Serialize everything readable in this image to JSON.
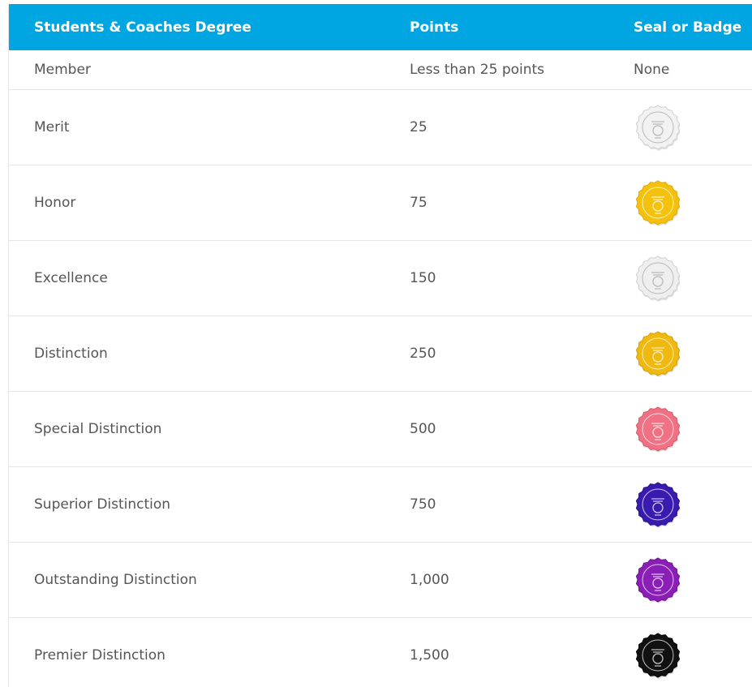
{
  "table": {
    "headers": {
      "degree": "Students & Coaches Degree",
      "points": "Points",
      "seal": "Seal or Badge"
    },
    "rows": [
      {
        "degree": "Member",
        "points": "Less than 25 points",
        "seal": "None"
      },
      {
        "degree": "Merit",
        "points": "25",
        "seal_color": "#f2f2f2",
        "seal_edge": "#d4d4d4",
        "seal_icon": "white-seal-icon"
      },
      {
        "degree": "Honor",
        "points": "75",
        "seal_color": "#f4c20d",
        "seal_edge": "#e0a800",
        "seal_icon": "gold-seal-icon"
      },
      {
        "degree": "Excellence",
        "points": "150",
        "seal_color": "#efefef",
        "seal_edge": "#cfcfcf",
        "seal_icon": "silver-seal-icon"
      },
      {
        "degree": "Distinction",
        "points": "250",
        "seal_color": "#f0b90f",
        "seal_edge": "#d79d00",
        "seal_icon": "gold-seal-icon"
      },
      {
        "degree": "Special Distinction",
        "points": "500",
        "seal_color": "#f07183",
        "seal_edge": "#d8566a",
        "seal_icon": "pink-seal-icon"
      },
      {
        "degree": "Superior Distinction",
        "points": "750",
        "seal_color": "#3a1bb0",
        "seal_edge": "#26108a",
        "seal_icon": "indigo-seal-icon"
      },
      {
        "degree": "Outstanding Distinction",
        "points": "1,000",
        "seal_color": "#8a1eb6",
        "seal_edge": "#6a1290",
        "seal_icon": "purple-seal-icon"
      },
      {
        "degree": "Premier Distinction",
        "points": "1,500",
        "seal_color": "#111111",
        "seal_edge": "#000000",
        "seal_icon": "black-seal-icon"
      }
    ]
  }
}
